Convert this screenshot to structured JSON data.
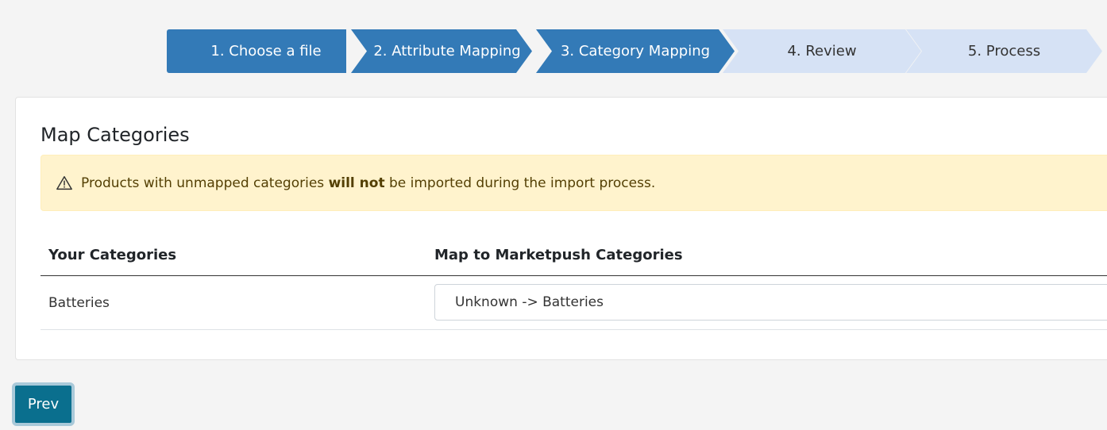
{
  "stepper": {
    "steps": [
      {
        "label": "1. Choose a file",
        "state": "done"
      },
      {
        "label": "2. Attribute Mapping",
        "state": "done"
      },
      {
        "label": "3. Category Mapping",
        "state": "current"
      },
      {
        "label": "4. Review",
        "state": "todo"
      },
      {
        "label": "5. Process",
        "state": "todo"
      }
    ],
    "colors": {
      "active": "#337ab7",
      "inactive": "#d6e2f5"
    }
  },
  "card": {
    "title": "Map Categories",
    "alert": {
      "icon": "warning-triangle-icon",
      "text_before": "Products with unmapped categories ",
      "text_bold": "will not",
      "text_after": " be imported during the import process.",
      "background": "#fff3cd"
    },
    "table": {
      "headers": [
        "Your Categories",
        "Map to Marketpush Categories"
      ],
      "rows": [
        {
          "category": "Batteries",
          "mapping": "Unknown -> Batteries"
        }
      ]
    }
  },
  "footer": {
    "prev_label": "Prev",
    "prev_color": "#0a6f8e"
  }
}
